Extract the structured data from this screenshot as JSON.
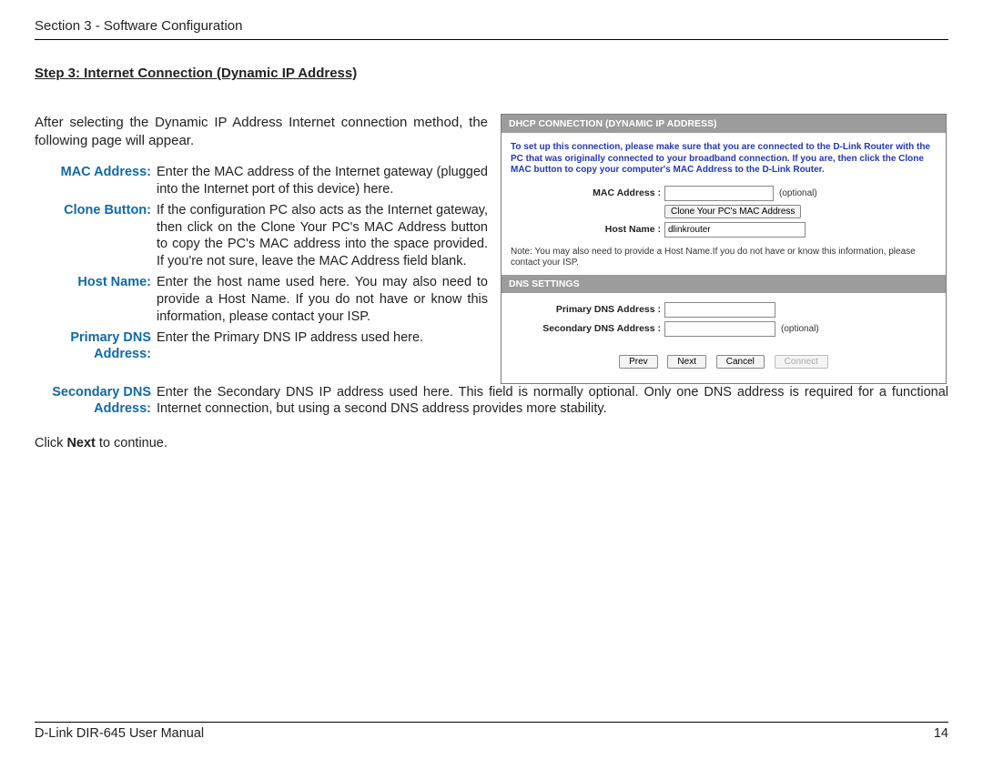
{
  "header": {
    "section": "Section 3 - Software Configuration"
  },
  "step_title": "Step 3: Internet Connection (Dynamic IP Address)",
  "intro": "After selecting the Dynamic IP Address Internet connection method, the following page will appear.",
  "defs": [
    {
      "term": "MAC Address:",
      "desc": "Enter the MAC address of the Internet gateway (plugged into the Internet port of this device) here."
    },
    {
      "term": "Clone Button:",
      "desc": "If the configuration PC also acts as the Internet gateway, then click on the Clone Your PC's MAC Address button to copy the PC's MAC address into the space provided. If you're not sure, leave the MAC Address field blank."
    },
    {
      "term": "Host Name:",
      "desc": "Enter the host name used here. You may also need to provide a Host Name. If you do not have or know this information, please contact your ISP."
    },
    {
      "term": "Primary DNS Address:",
      "desc": "Enter the Primary DNS IP address used here."
    },
    {
      "term": "Secondary DNS Address:",
      "desc": "Enter the Secondary DNS IP address used here. This field is normally optional. Only one DNS address is required for a functional Internet connection, but using a second DNS address provides more stability."
    }
  ],
  "outro_prefix": "Click ",
  "outro_bold": "Next",
  "outro_suffix": " to continue.",
  "panel": {
    "dhcp_header": "DHCP CONNECTION (DYNAMIC IP ADDRESS)",
    "instr": "To set up this connection, please make sure that you are connected to the D-Link Router with the PC that was originally connected to your broadband connection. If you are, then click the Clone MAC button to copy your computer's MAC Address to the D-Link Router.",
    "mac_label": "MAC Address :",
    "mac_value": "",
    "optional": "(optional)",
    "clone_label": "Clone Your PC's MAC Address",
    "host_label": "Host Name :",
    "host_value": "dlinkrouter",
    "host_note": "Note: You may also need to provide a Host Name.If you do not have or know this information, please contact your ISP.",
    "dns_header": "DNS SETTINGS",
    "primary_dns_label": "Primary DNS Address :",
    "primary_dns_value": "",
    "secondary_dns_label": "Secondary DNS Address :",
    "secondary_dns_value": "",
    "btn_prev": "Prev",
    "btn_next": "Next",
    "btn_cancel": "Cancel",
    "btn_connect": "Connect"
  },
  "footer": {
    "left": "D-Link DIR-645 User Manual",
    "right": "14"
  }
}
